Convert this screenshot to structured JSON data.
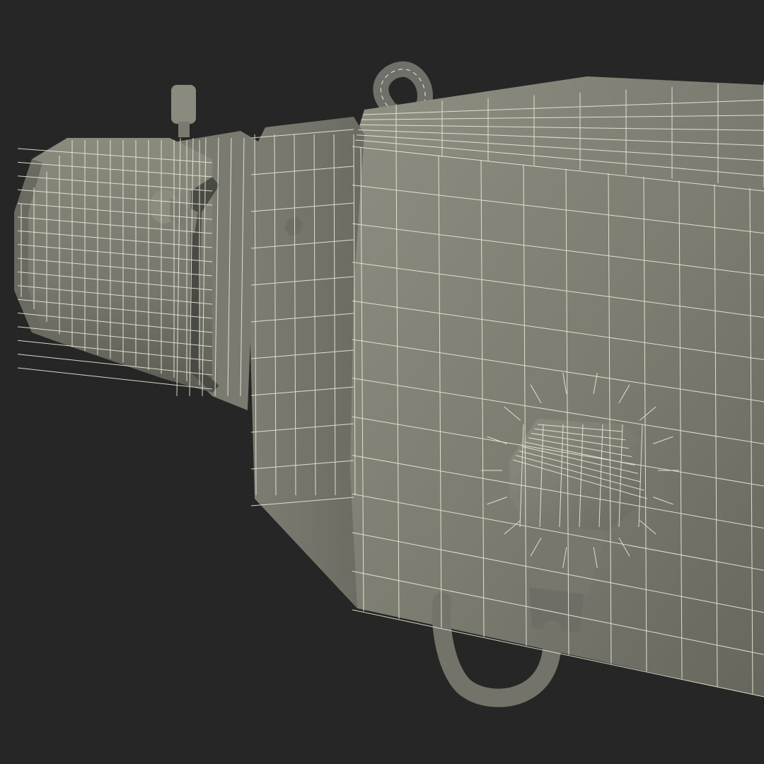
{
  "scene": {
    "subject": "wireframe-security-camera",
    "colors": {
      "background": "#262626",
      "surface_light": "#8a8a7e",
      "surface_mid": "#77776c",
      "surface_dark": "#5f5f56",
      "wire": "#ecebd8"
    }
  }
}
